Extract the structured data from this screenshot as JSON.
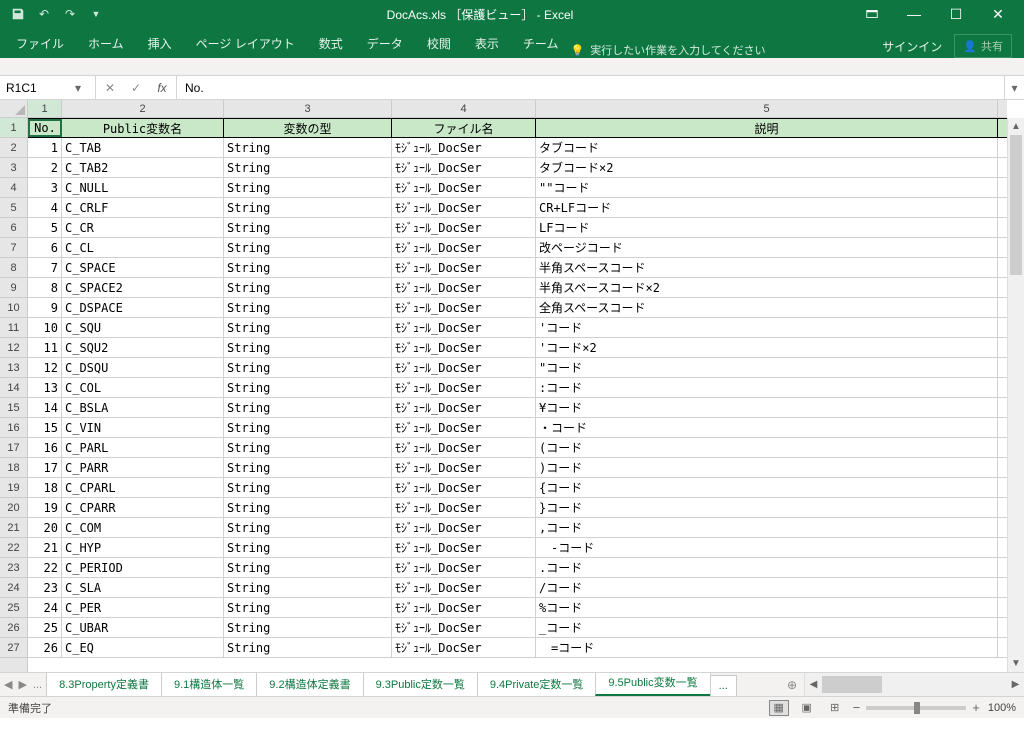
{
  "title_bar": {
    "title": "DocAcs.xls ［保護ビュー］ - Excel",
    "signin": "サインイン",
    "share": "共有"
  },
  "ribbon": {
    "tabs": [
      "ファイル",
      "ホーム",
      "挿入",
      "ページ レイアウト",
      "数式",
      "データ",
      "校閲",
      "表示",
      "チーム"
    ],
    "tell_me": "実行したい作業を入力してください"
  },
  "formula_bar": {
    "name_box": "R1C1",
    "formula": "No."
  },
  "columns": [
    "1",
    "2",
    "3",
    "4",
    "5"
  ],
  "col_widths": [
    "c1",
    "c2",
    "c3",
    "c4",
    "c5"
  ],
  "header_row": [
    "No.",
    "Public変数名",
    "変数の型",
    "ファイル名",
    "説明"
  ],
  "rows": [
    {
      "n": "1",
      "name": "C_TAB",
      "type": "String",
      "file": "ﾓｼﾞｭｰﾙ_DocSer",
      "desc": "タブコード"
    },
    {
      "n": "2",
      "name": "C_TAB2",
      "type": "String",
      "file": "ﾓｼﾞｭｰﾙ_DocSer",
      "desc": "タブコード×2"
    },
    {
      "n": "3",
      "name": "C_NULL",
      "type": "String",
      "file": "ﾓｼﾞｭｰﾙ_DocSer",
      "desc": "\"\"コード"
    },
    {
      "n": "4",
      "name": "C_CRLF",
      "type": "String",
      "file": "ﾓｼﾞｭｰﾙ_DocSer",
      "desc": "CR+LFコード"
    },
    {
      "n": "5",
      "name": "C_CR",
      "type": "String",
      "file": "ﾓｼﾞｭｰﾙ_DocSer",
      "desc": "LFコード"
    },
    {
      "n": "6",
      "name": "C_CL",
      "type": "String",
      "file": "ﾓｼﾞｭｰﾙ_DocSer",
      "desc": "改ページコード"
    },
    {
      "n": "7",
      "name": "C_SPACE",
      "type": "String",
      "file": "ﾓｼﾞｭｰﾙ_DocSer",
      "desc": "半角スペースコード"
    },
    {
      "n": "8",
      "name": "C_SPACE2",
      "type": "String",
      "file": "ﾓｼﾞｭｰﾙ_DocSer",
      "desc": "半角スペースコード×2"
    },
    {
      "n": "9",
      "name": "C_DSPACE",
      "type": "String",
      "file": "ﾓｼﾞｭｰﾙ_DocSer",
      "desc": "全角スペースコード"
    },
    {
      "n": "10",
      "name": "C_SQU",
      "type": "String",
      "file": "ﾓｼﾞｭｰﾙ_DocSer",
      "desc": "'コード"
    },
    {
      "n": "11",
      "name": "C_SQU2",
      "type": "String",
      "file": "ﾓｼﾞｭｰﾙ_DocSer",
      "desc": "'コード×2"
    },
    {
      "n": "12",
      "name": "C_DSQU",
      "type": "String",
      "file": "ﾓｼﾞｭｰﾙ_DocSer",
      "desc": "\"コード"
    },
    {
      "n": "13",
      "name": "C_COL",
      "type": "String",
      "file": "ﾓｼﾞｭｰﾙ_DocSer",
      "desc": ":コード"
    },
    {
      "n": "14",
      "name": "C_BSLA",
      "type": "String",
      "file": "ﾓｼﾞｭｰﾙ_DocSer",
      "desc": "¥コード"
    },
    {
      "n": "15",
      "name": "C_VIN",
      "type": "String",
      "file": "ﾓｼﾞｭｰﾙ_DocSer",
      "desc": "・コード"
    },
    {
      "n": "16",
      "name": "C_PARL",
      "type": "String",
      "file": "ﾓｼﾞｭｰﾙ_DocSer",
      "desc": "(コード"
    },
    {
      "n": "17",
      "name": "C_PARR",
      "type": "String",
      "file": "ﾓｼﾞｭｰﾙ_DocSer",
      "desc": ")コード"
    },
    {
      "n": "18",
      "name": "C_CPARL",
      "type": "String",
      "file": "ﾓｼﾞｭｰﾙ_DocSer",
      "desc": "{コード"
    },
    {
      "n": "19",
      "name": "C_CPARR",
      "type": "String",
      "file": "ﾓｼﾞｭｰﾙ_DocSer",
      "desc": "}コード"
    },
    {
      "n": "20",
      "name": "C_COM",
      "type": "String",
      "file": "ﾓｼﾞｭｰﾙ_DocSer",
      "desc": ",コード"
    },
    {
      "n": "21",
      "name": "C_HYP",
      "type": "String",
      "file": "ﾓｼﾞｭｰﾙ_DocSer",
      "desc": "　-コード"
    },
    {
      "n": "22",
      "name": "C_PERIOD",
      "type": "String",
      "file": "ﾓｼﾞｭｰﾙ_DocSer",
      "desc": ".コード"
    },
    {
      "n": "23",
      "name": "C_SLA",
      "type": "String",
      "file": "ﾓｼﾞｭｰﾙ_DocSer",
      "desc": "/コード"
    },
    {
      "n": "24",
      "name": "C_PER",
      "type": "String",
      "file": "ﾓｼﾞｭｰﾙ_DocSer",
      "desc": "%コード"
    },
    {
      "n": "25",
      "name": "C_UBAR",
      "type": "String",
      "file": "ﾓｼﾞｭｰﾙ_DocSer",
      "desc": "_コード"
    },
    {
      "n": "26",
      "name": "C_EQ",
      "type": "String",
      "file": "ﾓｼﾞｭｰﾙ_DocSer",
      "desc": "　=コード"
    }
  ],
  "sheet_tabs": {
    "items": [
      "8.3Property定義書",
      "9.1構造体一覧",
      "9.2構造体定義書",
      "9.3Public定数一覧",
      "9.4Private定数一覧",
      "9.5Public変数一覧"
    ],
    "active_index": 5,
    "more": "..."
  },
  "status_bar": {
    "ready": "準備完了",
    "zoom": "100%"
  }
}
